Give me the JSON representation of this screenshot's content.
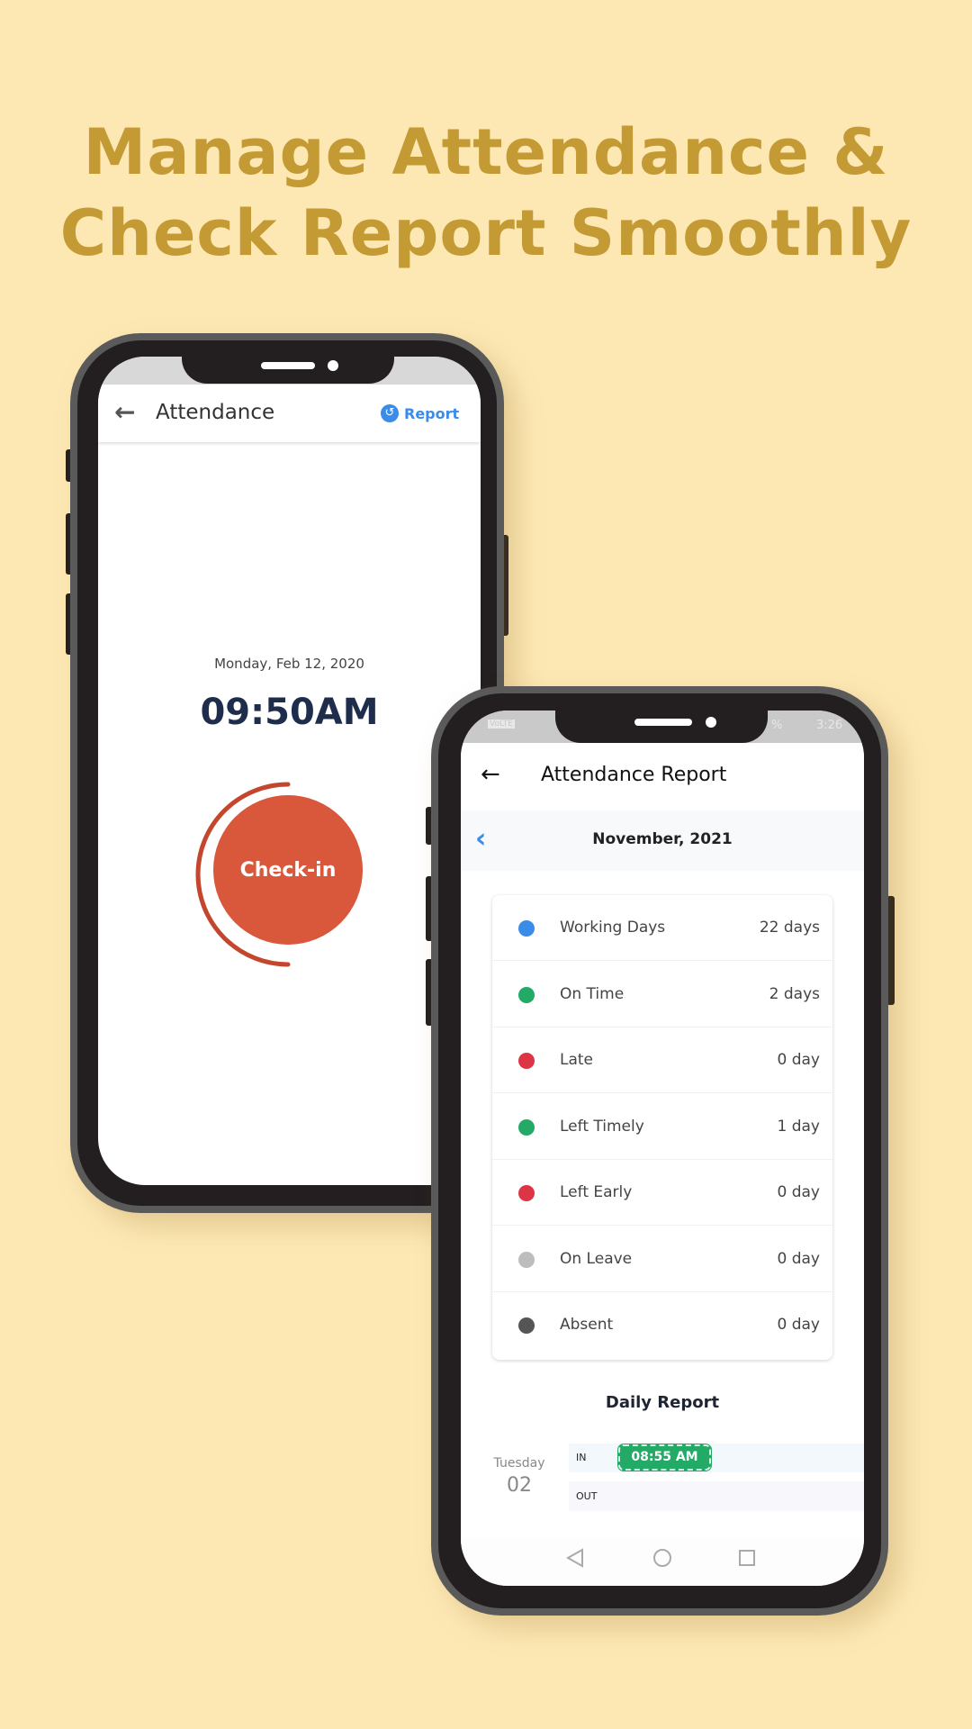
{
  "headline": {
    "line1": "Manage Attendance &",
    "line2": "Check Report Smoothly"
  },
  "colors": {
    "background": "#fde8b4",
    "headline": "#c49a35",
    "accent": "#3b8be8",
    "checkin": "#d9573a",
    "green": "#22aa66",
    "red": "#dc3545",
    "grey": "#bdbdbd",
    "dark": "#555555"
  },
  "phone1": {
    "header": {
      "back_icon": "arrow-left-icon",
      "title": "Attendance",
      "report_icon": "history-icon",
      "report_label": "Report"
    },
    "date": "Monday, Feb 12, 2020",
    "time": "09:50AM",
    "checkin_label": "Check-in"
  },
  "phone2": {
    "status": {
      "left": "VoLTE",
      "battery": "%",
      "time": "3:26"
    },
    "header": {
      "back_icon": "arrow-left-icon",
      "title": "Attendance Report"
    },
    "month": {
      "prev_icon": "chevron-left-icon",
      "label": "November, 2021"
    },
    "summary": [
      {
        "label": "Working Days",
        "value": "22 days",
        "color": "#3b8be8"
      },
      {
        "label": "On Time",
        "value": "2 days",
        "color": "#22aa66"
      },
      {
        "label": "Late",
        "value": "0 day",
        "color": "#dc3545"
      },
      {
        "label": "Left Timely",
        "value": "1 day",
        "color": "#22aa66"
      },
      {
        "label": "Left Early",
        "value": "0 day",
        "color": "#dc3545"
      },
      {
        "label": "On Leave",
        "value": "0 day",
        "color": "#bdbdbd"
      },
      {
        "label": "Absent",
        "value": "0 day",
        "color": "#555555"
      }
    ],
    "daily": {
      "title": "Daily Report",
      "day": "Tuesday",
      "date": "02",
      "in_label": "IN",
      "in_time": "08:55 AM",
      "out_label": "OUT"
    },
    "nav": {
      "back": "triangle-back-icon",
      "home": "circle-home-icon",
      "recent": "square-recent-icon"
    }
  }
}
